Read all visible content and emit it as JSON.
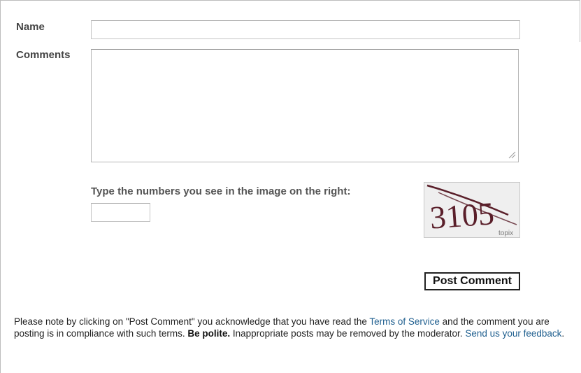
{
  "form": {
    "name_label": "Name",
    "name_value": "",
    "comments_label": "Comments",
    "comments_value": "",
    "captcha_prompt": "Type the numbers you see in the image on the right:",
    "captcha_value": "",
    "captcha_image": {
      "digits": "3105",
      "watermark": "topix",
      "digit_color": "#5a1f2a",
      "bg_color": "#efefef"
    },
    "post_button_label": "Post Comment"
  },
  "notice": {
    "text_1": "Please note by clicking on \"Post Comment\" you acknowledge that you have read the ",
    "terms_link": "Terms of Service",
    "text_2": " and the comment you are posting is in compliance with such terms. ",
    "be_polite": "Be polite.",
    "text_3": " Inappropriate posts may be removed by the moderator. ",
    "feedback_link": "Send us your feedback",
    "text_4": "."
  },
  "colors": {
    "link": "#1f5f8f",
    "label": "#444444",
    "border": "#bdbdbd"
  }
}
